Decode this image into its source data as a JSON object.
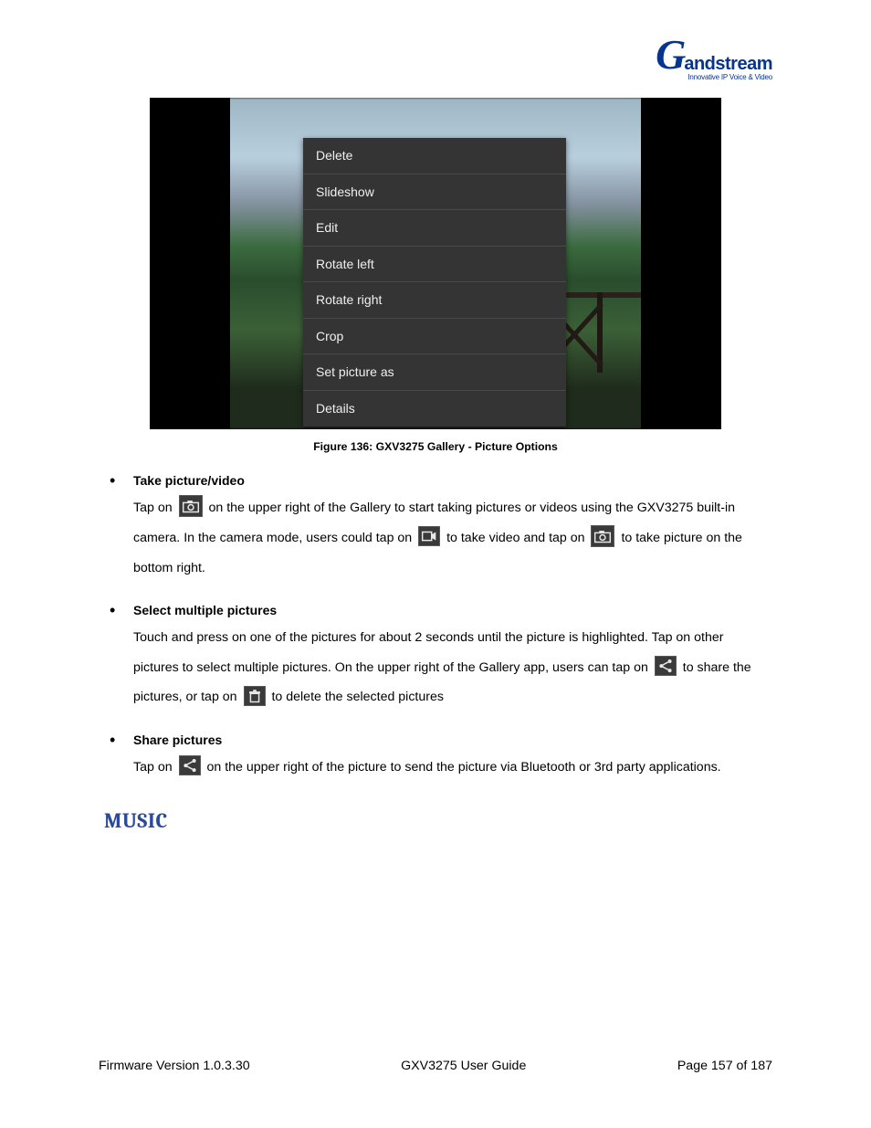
{
  "logo": {
    "brand_g": "G",
    "brand_rest": "andstream",
    "tagline": "Innovative IP Voice & Video"
  },
  "screenshot": {
    "menu": [
      "Delete",
      "Slideshow",
      "Edit",
      "Rotate left",
      "Rotate right",
      "Crop",
      "Set picture as",
      "Details"
    ],
    "caption": "Figure 136: GXV3275 Gallery - Picture Options"
  },
  "bullets": {
    "b1": {
      "heading": "Take picture/video",
      "t1": "Tap on ",
      "t2": " on the upper right of the Gallery to start taking pictures or videos using the GXV3275 built-in camera. In the camera mode, users could tap on ",
      "t3": " to take video and tap on ",
      "t4": " to take picture on the bottom right."
    },
    "b2": {
      "heading": "Select multiple pictures",
      "t1": "Touch and press on one of the pictures for about 2 seconds until the picture is highlighted. Tap on other pictures to select multiple pictures. On the upper right of the Gallery app, users can tap on ",
      "t2": " to share the pictures, or tap on ",
      "t3": " to delete the selected pictures"
    },
    "b3": {
      "heading": "Share pictures",
      "t1": "Tap on ",
      "t2": " on the upper right of the picture to send the picture via Bluetooth or 3rd party applications."
    }
  },
  "section_heading": "MUSIC",
  "footer": {
    "left": "Firmware Version 1.0.3.30",
    "center": "GXV3275 User Guide",
    "right": "Page 157 of 187"
  }
}
